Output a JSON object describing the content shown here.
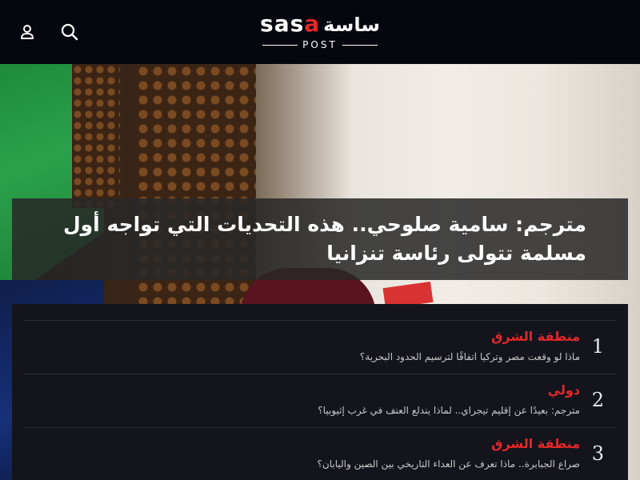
{
  "header": {
    "logo": {
      "latin_prefix": "sas",
      "latin_accent": "a",
      "arabic": "ساسة",
      "sub": "POST"
    },
    "icons": [
      "user-icon",
      "search-icon"
    ]
  },
  "hero": {
    "headline": "مترجم: سامية صلوحي.. هذه التحديات التي تواجه أول مسلمة تتولى رئاسة تنزانيا"
  },
  "list": {
    "items": [
      {
        "number": "1",
        "category": "منطقة الشرق",
        "title": "ماذا لو وقعت مصر وتركيا اتفاقًا لترسيم الحدود البحرية؟"
      },
      {
        "number": "2",
        "category": "دولي",
        "title": "مترجم: بعيدًا عن إقليم تيجراي.. لماذا يندلع العنف في غرب إثيوبيا؟"
      },
      {
        "number": "3",
        "category": "منطقة الشرق",
        "title": "صراع الجبابرة.. ماذا تعرف عن العداء التاريخي بين الصين واليابان؟"
      }
    ]
  },
  "colors": {
    "accent": "#e42828",
    "header_bg": "#06060f",
    "panel_bg": "#14141d"
  }
}
